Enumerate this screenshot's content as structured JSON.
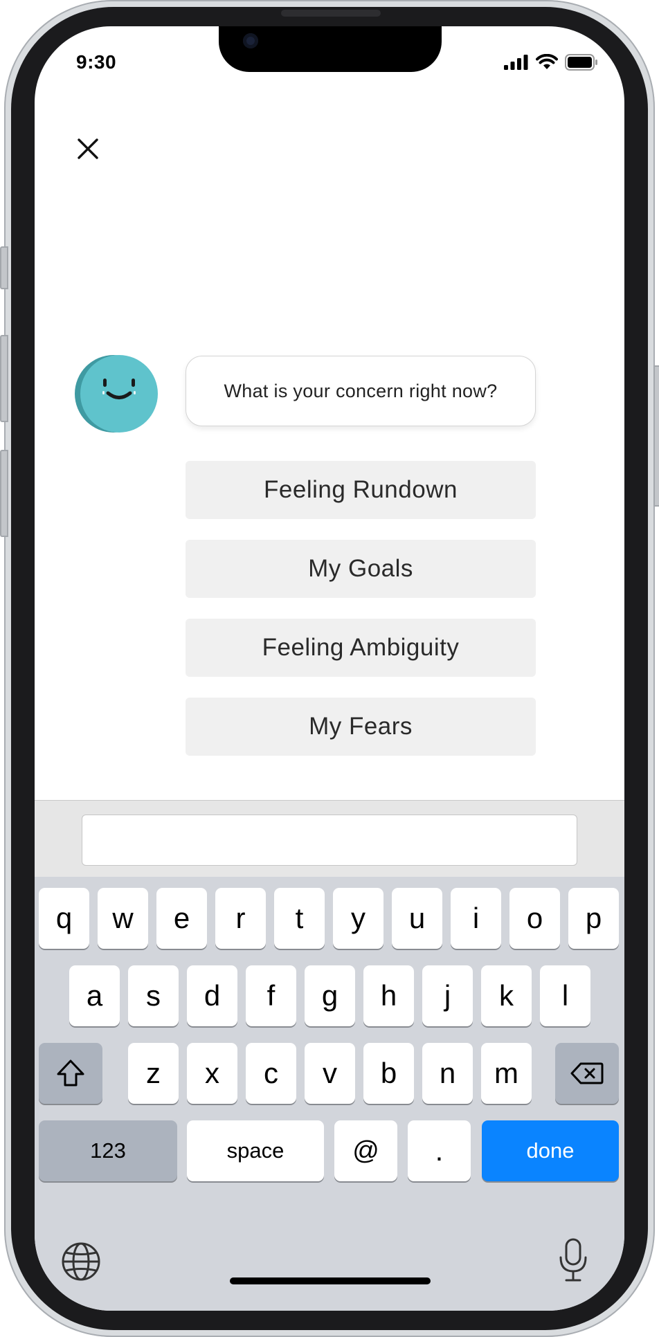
{
  "status_bar": {
    "time": "9:30"
  },
  "chat": {
    "close_icon": "close-icon",
    "prompt": "What is your concern right now?",
    "options": [
      "Feeling Rundown",
      "My Goals",
      "Feeling Ambiguity",
      "My Fears"
    ]
  },
  "input": {
    "value": "",
    "placeholder": ""
  },
  "keyboard": {
    "row1": [
      "q",
      "w",
      "e",
      "r",
      "t",
      "y",
      "u",
      "i",
      "o",
      "p"
    ],
    "row2": [
      "a",
      "s",
      "d",
      "f",
      "g",
      "h",
      "j",
      "k",
      "l"
    ],
    "row3": [
      "z",
      "x",
      "c",
      "v",
      "b",
      "n",
      "m"
    ],
    "numbers_label": "123",
    "space_label": "space",
    "at_label": "@",
    "period_label": ".",
    "done_label": "done"
  },
  "colors": {
    "accent": "#0a84ff",
    "avatar": "#5fc3cc",
    "option_bg": "#f0f0f0",
    "keyboard_bg": "#d2d5db"
  }
}
